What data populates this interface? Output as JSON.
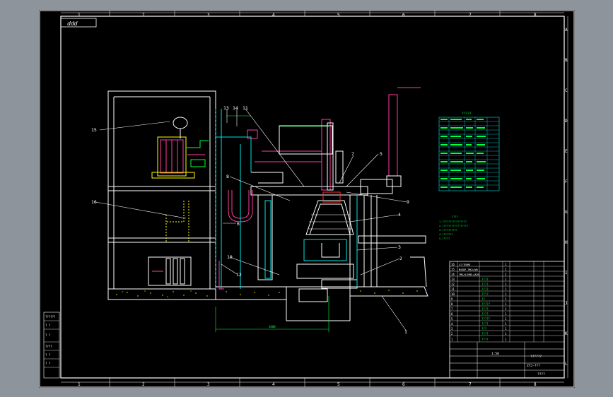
{
  "colors": {
    "background": "#000000",
    "window": "#8e949c",
    "frame": "#ffffff",
    "cyan": "#00e5e5",
    "green": "#00ff3c",
    "magenta": "#ff3ca0",
    "yellow": "#ffff00",
    "red": "#ff3030"
  },
  "drawing": {
    "title_tab": "ddd",
    "column_markers": [
      "1",
      "2",
      "3",
      "4",
      "5",
      "6",
      "7",
      "8"
    ],
    "row_markers": [
      "A",
      "B",
      "C",
      "D",
      "E",
      "F",
      "G",
      "H",
      "I",
      "J",
      "K",
      "L"
    ],
    "leader_numbers": [
      "15",
      "16",
      "13",
      "14",
      "11",
      "7",
      "5",
      "8",
      "9",
      "4",
      "6",
      "3",
      "10",
      "12",
      "2",
      "1"
    ],
    "dimension_bottom": "1000",
    "table_title": "?????",
    "notes_title": "????",
    "notes": [
      "1.????????????????",
      "2.?????????????????",
      "3.??????????",
      "4.???????",
      "5.?????"
    ],
    "bom": [
      {
        "no": "16",
        "name": "LT/TERM3",
        "qty": "1"
      },
      {
        "no": "15",
        "name": "M45DP-TMG/AVW",
        "qty": "1"
      },
      {
        "no": "14",
        "name": "TMG/AJEMB-AA2B",
        "qty": "2"
      },
      {
        "no": "13",
        "name": "????",
        "qty": "1"
      },
      {
        "no": "12",
        "name": "????",
        "qty": "1"
      },
      {
        "no": "11",
        "name": "????",
        "qty": "1"
      },
      {
        "no": "10",
        "name": "????",
        "qty": "1"
      },
      {
        "no": "9",
        "name": "??",
        "qty": "1"
      },
      {
        "no": "8",
        "name": "?????",
        "qty": "1"
      },
      {
        "no": "7",
        "name": "????",
        "qty": "1"
      },
      {
        "no": "6",
        "name": "????",
        "qty": "1"
      },
      {
        "no": "5",
        "name": "?????",
        "qty": "1"
      },
      {
        "no": "4",
        "name": "????",
        "qty": "1"
      },
      {
        "no": "3",
        "name": "???",
        "qty": "1"
      },
      {
        "no": "2",
        "name": "????",
        "qty": "1"
      },
      {
        "no": "1",
        "name": "????",
        "qty": "1"
      }
    ],
    "title_block": {
      "scale": "1:50",
      "drawing_name": "??????",
      "drawing_no": "ZYJ-???",
      "org": "????"
    },
    "left_stamp": [
      "??????",
      "? ?",
      "? ?",
      "????",
      "? ?",
      "? ?"
    ]
  }
}
